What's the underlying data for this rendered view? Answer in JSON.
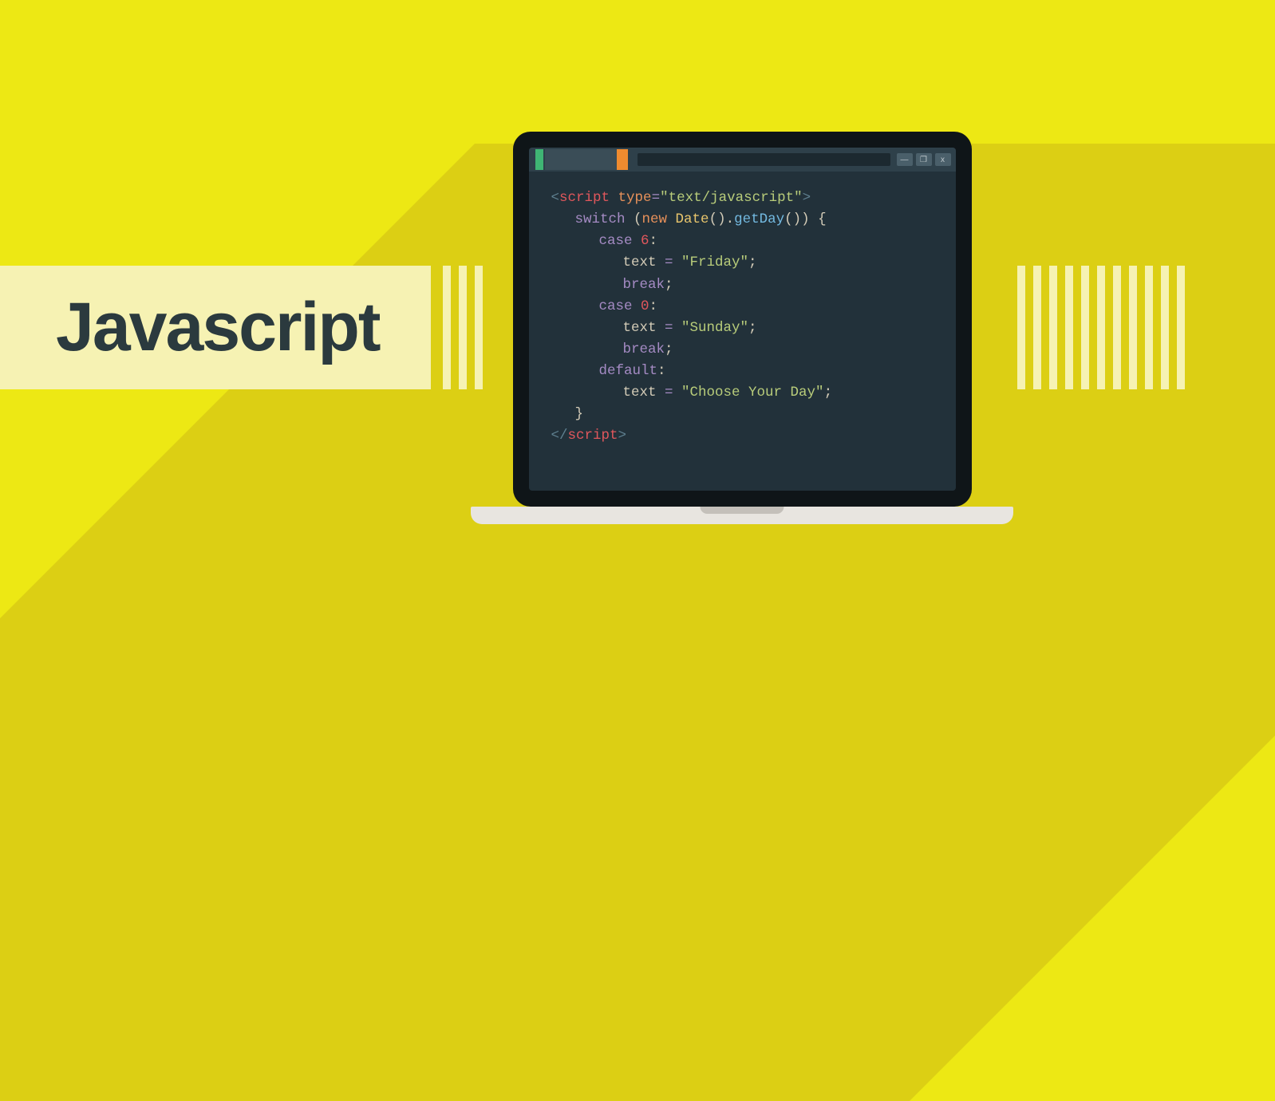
{
  "title": "Javascript",
  "win_controls": {
    "min": "—",
    "max": "❐",
    "close": "x"
  },
  "code": {
    "l1": {
      "open": "<",
      "tag": "script",
      "sp": " ",
      "attr": "type",
      "eq": "=",
      "str": "\"text/javascript\"",
      "close": ">"
    },
    "l2": {
      "kw": "switch ",
      "p1": "(",
      "new": "new ",
      "cls": "Date",
      "p2": "().",
      "m": "getDay",
      "p3": "()) ",
      "br": "{"
    },
    "l3": {
      "kw": "case ",
      "n": "6",
      "c": ":"
    },
    "l4": {
      "v": "text ",
      "eq": "= ",
      "s": "\"Friday\"",
      "sc": ";"
    },
    "l5": {
      "kw": "break",
      "sc": ";"
    },
    "l6": {
      "kw": "case ",
      "n": "0",
      "c": ":"
    },
    "l7": {
      "v": "text ",
      "eq": "= ",
      "s": "\"Sunday\"",
      "sc": ";"
    },
    "l8": {
      "kw": "break",
      "sc": ";"
    },
    "l9": {
      "kw": "default",
      "c": ":"
    },
    "l10": {
      "v": "text ",
      "eq": "= ",
      "s": "\"Choose Your Day\"",
      "sc": ";"
    },
    "l11": {
      "br": "}"
    },
    "l12": {
      "open": "</",
      "tag": "script",
      "close": ">"
    }
  }
}
